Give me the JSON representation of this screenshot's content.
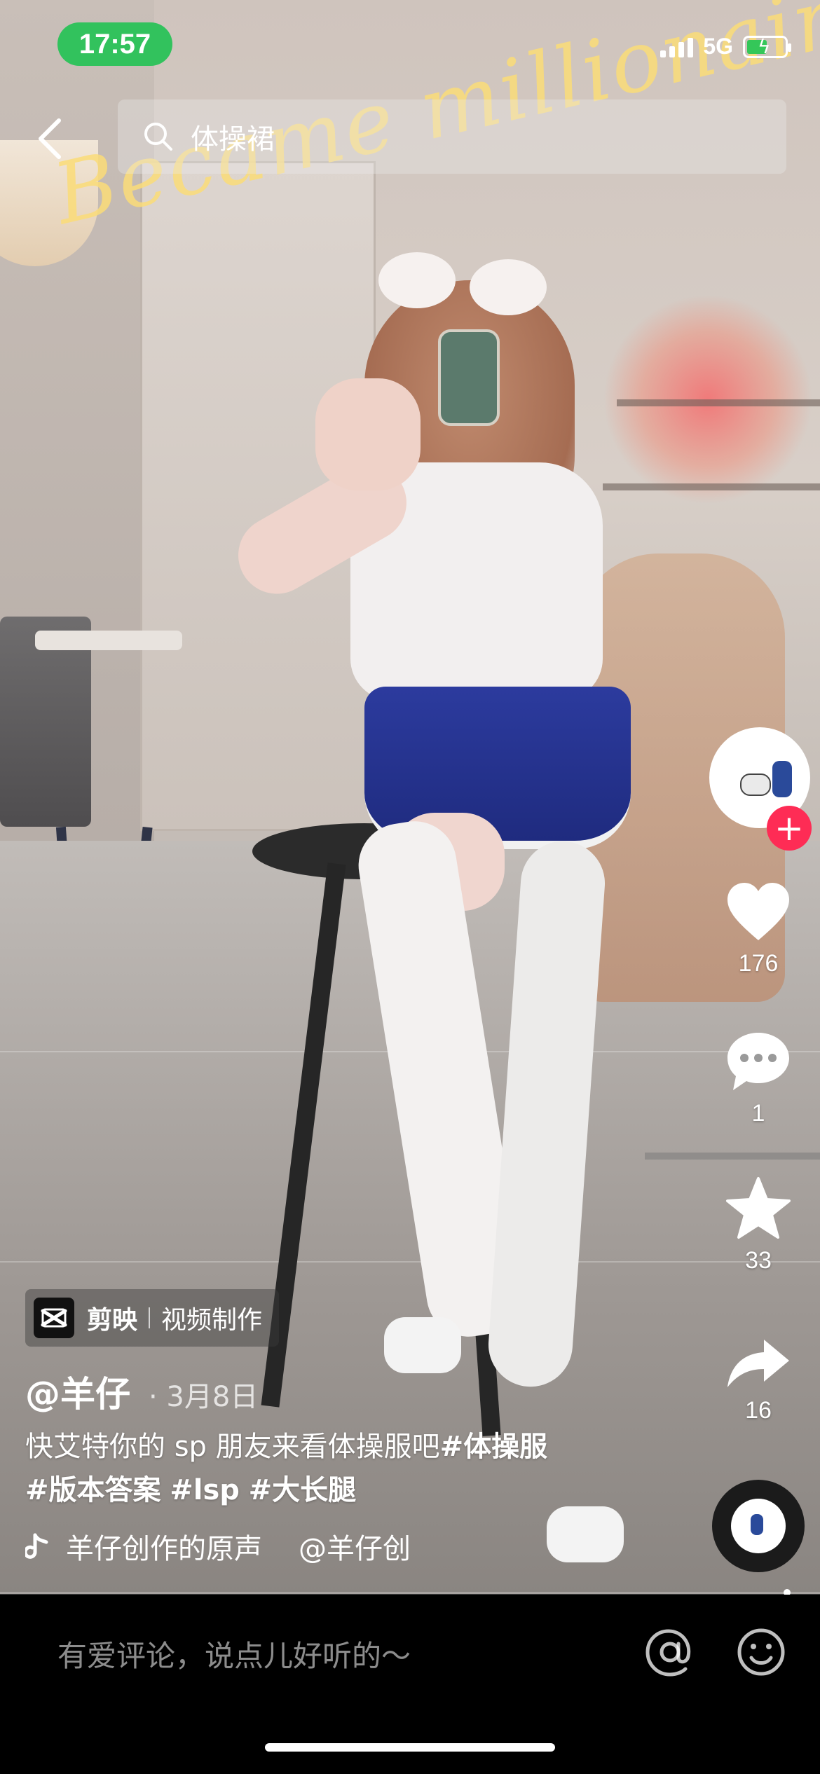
{
  "status_bar": {
    "time": "17:57",
    "network": "5G"
  },
  "search": {
    "query": "体操裙"
  },
  "video": {
    "overlay_text": "Became millionaire"
  },
  "right_rail": {
    "likes": "176",
    "comments": "1",
    "favorites": "33",
    "shares": "16",
    "follow_symbol": "+"
  },
  "capcut_tag": {
    "app": "剪映",
    "label": "视频制作"
  },
  "post": {
    "author": "@羊仔",
    "date": "· 3月8日",
    "caption_text": "快艾特你的 sp 朋友来看体操服吧",
    "hashtags": [
      "#体操服",
      "#版本答案",
      "#lsp",
      "#大长腿"
    ],
    "music_title": "羊仔创作的原声",
    "music_author": "@羊仔创"
  },
  "comment_bar": {
    "placeholder": "有爱评论，说点儿好听的～"
  },
  "icons": [
    "back-arrow-icon",
    "search-icon",
    "heart-icon",
    "comment-icon",
    "star-icon",
    "share-icon",
    "music-note-icon",
    "at-icon",
    "emoji-icon",
    "capcut-logo-icon"
  ],
  "colors": {
    "accent_red": "#fe2c55",
    "time_pill": "#32c25d",
    "bar_bg": "#000000"
  }
}
